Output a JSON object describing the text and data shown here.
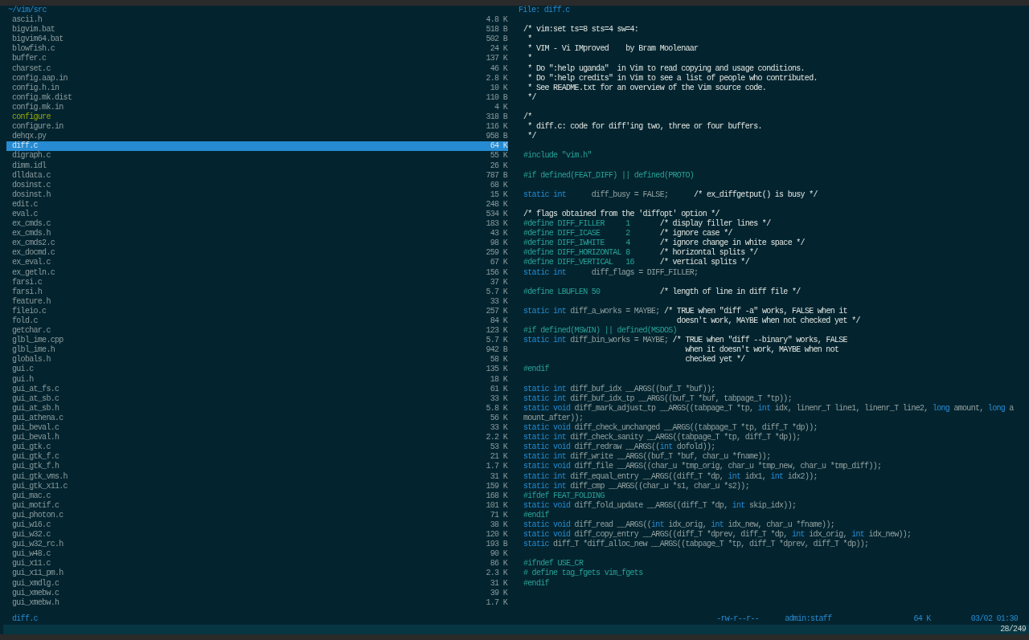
{
  "browser": {
    "path": "~/vim/src",
    "files": [
      {
        "name": "ascii.h",
        "size": "4.8 K",
        "kind": "file",
        "selected": false
      },
      {
        "name": "bigvim.bat",
        "size": "518 B",
        "kind": "file",
        "selected": false
      },
      {
        "name": "bigvim64.bat",
        "size": "502 B",
        "kind": "file",
        "selected": false
      },
      {
        "name": "blowfish.c",
        "size": "24 K",
        "kind": "file",
        "selected": false
      },
      {
        "name": "buffer.c",
        "size": "137 K",
        "kind": "file",
        "selected": false
      },
      {
        "name": "charset.c",
        "size": "46 K",
        "kind": "file",
        "selected": false
      },
      {
        "name": "config.aap.in",
        "size": "2.8 K",
        "kind": "file",
        "selected": false
      },
      {
        "name": "config.h.in",
        "size": "10 K",
        "kind": "file",
        "selected": false
      },
      {
        "name": "config.mk.dist",
        "size": "110 B",
        "kind": "file",
        "selected": false
      },
      {
        "name": "config.mk.in",
        "size": "4 K",
        "kind": "file",
        "selected": false
      },
      {
        "name": "configure",
        "size": "318 B",
        "kind": "executable",
        "selected": false
      },
      {
        "name": "configure.in",
        "size": "116 K",
        "kind": "file",
        "selected": false
      },
      {
        "name": "dehqx.py",
        "size": "958 B",
        "kind": "file",
        "selected": false
      },
      {
        "name": "diff.c",
        "size": "64 K",
        "kind": "file",
        "selected": true
      },
      {
        "name": "digraph.c",
        "size": "55 K",
        "kind": "file",
        "selected": false
      },
      {
        "name": "dimm.idl",
        "size": "26 K",
        "kind": "file",
        "selected": false
      },
      {
        "name": "dlldata.c",
        "size": "787 B",
        "kind": "file",
        "selected": false
      },
      {
        "name": "dosinst.c",
        "size": "68 K",
        "kind": "file",
        "selected": false
      },
      {
        "name": "dosinst.h",
        "size": "15 K",
        "kind": "file",
        "selected": false
      },
      {
        "name": "edit.c",
        "size": "248 K",
        "kind": "file",
        "selected": false
      },
      {
        "name": "eval.c",
        "size": "534 K",
        "kind": "file",
        "selected": false
      },
      {
        "name": "ex_cmds.c",
        "size": "183 K",
        "kind": "file",
        "selected": false
      },
      {
        "name": "ex_cmds.h",
        "size": "43 K",
        "kind": "file",
        "selected": false
      },
      {
        "name": "ex_cmds2.c",
        "size": "98 K",
        "kind": "file",
        "selected": false
      },
      {
        "name": "ex_docmd.c",
        "size": "259 K",
        "kind": "file",
        "selected": false
      },
      {
        "name": "ex_eval.c",
        "size": "67 K",
        "kind": "file",
        "selected": false
      },
      {
        "name": "ex_getln.c",
        "size": "156 K",
        "kind": "file",
        "selected": false
      },
      {
        "name": "farsi.c",
        "size": "37 K",
        "kind": "file",
        "selected": false
      },
      {
        "name": "farsi.h",
        "size": "5.7 K",
        "kind": "file",
        "selected": false
      },
      {
        "name": "feature.h",
        "size": "33 K",
        "kind": "file",
        "selected": false
      },
      {
        "name": "fileio.c",
        "size": "257 K",
        "kind": "file",
        "selected": false
      },
      {
        "name": "fold.c",
        "size": "84 K",
        "kind": "file",
        "selected": false
      },
      {
        "name": "getchar.c",
        "size": "123 K",
        "kind": "file",
        "selected": false
      },
      {
        "name": "glbl_ime.cpp",
        "size": "5.7 K",
        "kind": "file",
        "selected": false
      },
      {
        "name": "glbl_ime.h",
        "size": "942 B",
        "kind": "file",
        "selected": false
      },
      {
        "name": "globals.h",
        "size": "58 K",
        "kind": "file",
        "selected": false
      },
      {
        "name": "gui.c",
        "size": "135 K",
        "kind": "file",
        "selected": false
      },
      {
        "name": "gui.h",
        "size": "18 K",
        "kind": "file",
        "selected": false
      },
      {
        "name": "gui_at_fs.c",
        "size": "61 K",
        "kind": "file",
        "selected": false
      },
      {
        "name": "gui_at_sb.c",
        "size": "33 K",
        "kind": "file",
        "selected": false
      },
      {
        "name": "gui_at_sb.h",
        "size": "5.8 K",
        "kind": "file",
        "selected": false
      },
      {
        "name": "gui_athena.c",
        "size": "56 K",
        "kind": "file",
        "selected": false
      },
      {
        "name": "gui_beval.c",
        "size": "33 K",
        "kind": "file",
        "selected": false
      },
      {
        "name": "gui_beval.h",
        "size": "2.2 K",
        "kind": "file",
        "selected": false
      },
      {
        "name": "gui_gtk.c",
        "size": "53 K",
        "kind": "file",
        "selected": false
      },
      {
        "name": "gui_gtk_f.c",
        "size": "21 K",
        "kind": "file",
        "selected": false
      },
      {
        "name": "gui_gtk_f.h",
        "size": "1.7 K",
        "kind": "file",
        "selected": false
      },
      {
        "name": "gui_gtk_vms.h",
        "size": "31 K",
        "kind": "file",
        "selected": false
      },
      {
        "name": "gui_gtk_x11.c",
        "size": "159 K",
        "kind": "file",
        "selected": false
      },
      {
        "name": "gui_mac.c",
        "size": "168 K",
        "kind": "file",
        "selected": false
      },
      {
        "name": "gui_motif.c",
        "size": "101 K",
        "kind": "file",
        "selected": false
      },
      {
        "name": "gui_photon.c",
        "size": "71 K",
        "kind": "file",
        "selected": false
      },
      {
        "name": "gui_w16.c",
        "size": "38 K",
        "kind": "file",
        "selected": false
      },
      {
        "name": "gui_w32.c",
        "size": "120 K",
        "kind": "file",
        "selected": false
      },
      {
        "name": "gui_w32_rc.h",
        "size": "193 B",
        "kind": "file",
        "selected": false
      },
      {
        "name": "gui_w48.c",
        "size": "90 K",
        "kind": "file",
        "selected": false
      },
      {
        "name": "gui_x11.c",
        "size": "86 K",
        "kind": "file",
        "selected": false
      },
      {
        "name": "gui_x11_pm.h",
        "size": "2.3 K",
        "kind": "file",
        "selected": false
      },
      {
        "name": "gui_xmdlg.c",
        "size": "31 K",
        "kind": "file",
        "selected": false
      },
      {
        "name": "gui_xmebw.c",
        "size": "39 K",
        "kind": "file",
        "selected": false
      },
      {
        "name": "gui_xmebw.h",
        "size": "1.7 K",
        "kind": "file",
        "selected": false
      }
    ],
    "current_file": "diff.c"
  },
  "preview": {
    "title": "File: diff.c",
    "lines": [
      {
        "kind": "code",
        "segments": [
          {
            "kind": "comment",
            "text": "/* vim:set ts=8 sts=4 sw=4:"
          }
        ]
      },
      {
        "kind": "code",
        "segments": [
          {
            "kind": "comment",
            "text": " *"
          }
        ]
      },
      {
        "kind": "code",
        "segments": [
          {
            "kind": "comment",
            "text": " * VIM - Vi IMproved    by Bram Moolenaar"
          }
        ]
      },
      {
        "kind": "code",
        "segments": [
          {
            "kind": "comment",
            "text": " *"
          }
        ]
      },
      {
        "kind": "code",
        "segments": [
          {
            "kind": "comment",
            "text": " * Do \":help uganda\"  in Vim to read copying and usage conditions."
          }
        ]
      },
      {
        "kind": "code",
        "segments": [
          {
            "kind": "comment",
            "text": " * Do \":help credits\" in Vim to see a list of people who contributed."
          }
        ]
      },
      {
        "kind": "code",
        "segments": [
          {
            "kind": "comment",
            "text": " * See README.txt for an overview of the Vim source code."
          }
        ]
      },
      {
        "kind": "code",
        "segments": [
          {
            "kind": "comment",
            "text": " */"
          }
        ]
      },
      {
        "kind": "blank"
      },
      {
        "kind": "code",
        "segments": [
          {
            "kind": "comment",
            "text": "/*"
          }
        ]
      },
      {
        "kind": "code",
        "segments": [
          {
            "kind": "comment",
            "text": " * diff.c: code for diff'ing two, three or four buffers."
          }
        ]
      },
      {
        "kind": "code",
        "segments": [
          {
            "kind": "comment",
            "text": " */"
          }
        ]
      },
      {
        "kind": "blank"
      },
      {
        "kind": "code",
        "segments": [
          {
            "kind": "preproc",
            "text": "#include \"vim.h\""
          }
        ]
      },
      {
        "kind": "blank"
      },
      {
        "kind": "code",
        "segments": [
          {
            "kind": "preproc",
            "text": "#if defined(FEAT_DIFF) || defined(PROTO)"
          }
        ]
      },
      {
        "kind": "blank"
      },
      {
        "kind": "code",
        "segments": [
          {
            "kind": "keyword",
            "text": "static int"
          },
          {
            "kind": "plain",
            "text": "      diff_busy = FALSE;      "
          },
          {
            "kind": "comment",
            "text": "/* ex_diffgetput() is busy */"
          }
        ]
      },
      {
        "kind": "blank"
      },
      {
        "kind": "code",
        "segments": [
          {
            "kind": "comment",
            "text": "/* flags obtained from the 'diffopt' option */"
          }
        ]
      },
      {
        "kind": "code",
        "segments": [
          {
            "kind": "preproc",
            "text": "#define DIFF_FILLER     1       "
          },
          {
            "kind": "comment",
            "text": "/* display filler lines */"
          }
        ]
      },
      {
        "kind": "code",
        "segments": [
          {
            "kind": "preproc",
            "text": "#define DIFF_ICASE      2       "
          },
          {
            "kind": "comment",
            "text": "/* ignore case */"
          }
        ]
      },
      {
        "kind": "code",
        "segments": [
          {
            "kind": "preproc",
            "text": "#define DIFF_IWHITE     4       "
          },
          {
            "kind": "comment",
            "text": "/* ignore change in white space */"
          }
        ]
      },
      {
        "kind": "code",
        "segments": [
          {
            "kind": "preproc",
            "text": "#define DIFF_HORIZONTAL 8       "
          },
          {
            "kind": "comment",
            "text": "/* horizontal splits */"
          }
        ]
      },
      {
        "kind": "code",
        "segments": [
          {
            "kind": "preproc",
            "text": "#define DIFF_VERTICAL   16      "
          },
          {
            "kind": "comment",
            "text": "/* vertical splits */"
          }
        ]
      },
      {
        "kind": "code",
        "segments": [
          {
            "kind": "keyword",
            "text": "static int"
          },
          {
            "kind": "plain",
            "text": "      diff_flags = DIFF_FILLER;"
          }
        ]
      },
      {
        "kind": "blank"
      },
      {
        "kind": "code",
        "segments": [
          {
            "kind": "preproc",
            "text": "#define LBUFLEN 50              "
          },
          {
            "kind": "comment",
            "text": "/* length of line in diff file */"
          }
        ]
      },
      {
        "kind": "blank"
      },
      {
        "kind": "code",
        "segments": [
          {
            "kind": "keyword",
            "text": "static int"
          },
          {
            "kind": "plain",
            "text": " diff_a_works = MAYBE; "
          },
          {
            "kind": "comment",
            "text": "/* TRUE when \"diff -a\" works, FALSE when it"
          }
        ]
      },
      {
        "kind": "code",
        "segments": [
          {
            "kind": "comment",
            "text": "                                    doesn't work, MAYBE when not checked yet */"
          }
        ]
      },
      {
        "kind": "code",
        "segments": [
          {
            "kind": "preproc",
            "text": "#if defined(MSWIN) || defined(MSDOS)"
          }
        ]
      },
      {
        "kind": "code",
        "segments": [
          {
            "kind": "keyword",
            "text": "static int"
          },
          {
            "kind": "plain",
            "text": " diff_bin_works = MAYBE; "
          },
          {
            "kind": "comment",
            "text": "/* TRUE when \"diff --binary\" works, FALSE"
          }
        ]
      },
      {
        "kind": "code",
        "segments": [
          {
            "kind": "comment",
            "text": "                                      when it doesn't work, MAYBE when not"
          }
        ]
      },
      {
        "kind": "code",
        "segments": [
          {
            "kind": "comment",
            "text": "                                      checked yet */"
          }
        ]
      },
      {
        "kind": "code",
        "segments": [
          {
            "kind": "preproc",
            "text": "#endif"
          }
        ]
      },
      {
        "kind": "blank"
      },
      {
        "kind": "code",
        "segments": [
          {
            "kind": "keyword",
            "text": "static int"
          },
          {
            "kind": "plain",
            "text": " diff_buf_idx __ARGS((buf_T *buf));"
          }
        ]
      },
      {
        "kind": "code",
        "segments": [
          {
            "kind": "keyword",
            "text": "static int"
          },
          {
            "kind": "plain",
            "text": " diff_buf_idx_tp __ARGS((buf_T *buf, tabpage_T *tp));"
          }
        ]
      },
      {
        "kind": "code",
        "segments": [
          {
            "kind": "keyword",
            "text": "static void"
          },
          {
            "kind": "plain",
            "text": " diff_mark_adjust_tp __ARGS((tabpage_T *tp, "
          },
          {
            "kind": "keyword",
            "text": "int"
          },
          {
            "kind": "plain",
            "text": " idx, linenr_T line1, linenr_T line2, "
          },
          {
            "kind": "keyword",
            "text": "long"
          },
          {
            "kind": "plain",
            "text": " amount, "
          },
          {
            "kind": "keyword",
            "text": "long"
          },
          {
            "kind": "plain",
            "text": " a"
          }
        ]
      },
      {
        "kind": "code",
        "segments": [
          {
            "kind": "plain",
            "text": "mount_after));"
          }
        ]
      },
      {
        "kind": "code",
        "segments": [
          {
            "kind": "keyword",
            "text": "static void"
          },
          {
            "kind": "plain",
            "text": " diff_check_unchanged __ARGS((tabpage_T *tp, diff_T *dp));"
          }
        ]
      },
      {
        "kind": "code",
        "segments": [
          {
            "kind": "keyword",
            "text": "static int"
          },
          {
            "kind": "plain",
            "text": " diff_check_sanity __ARGS((tabpage_T *tp, diff_T *dp));"
          }
        ]
      },
      {
        "kind": "code",
        "segments": [
          {
            "kind": "keyword",
            "text": "static void"
          },
          {
            "kind": "plain",
            "text": " diff_redraw __ARGS(("
          },
          {
            "kind": "keyword",
            "text": "int"
          },
          {
            "kind": "plain",
            "text": " dofold));"
          }
        ]
      },
      {
        "kind": "code",
        "segments": [
          {
            "kind": "keyword",
            "text": "static int"
          },
          {
            "kind": "plain",
            "text": " diff_write __ARGS((buf_T *buf, char_u *fname));"
          }
        ]
      },
      {
        "kind": "code",
        "segments": [
          {
            "kind": "keyword",
            "text": "static void"
          },
          {
            "kind": "plain",
            "text": " diff_file __ARGS((char_u *tmp_orig, char_u *tmp_new, char_u *tmp_diff));"
          }
        ]
      },
      {
        "kind": "code",
        "segments": [
          {
            "kind": "keyword",
            "text": "static int"
          },
          {
            "kind": "plain",
            "text": " diff_equal_entry __ARGS((diff_T *dp, "
          },
          {
            "kind": "keyword",
            "text": "int"
          },
          {
            "kind": "plain",
            "text": " idx1, "
          },
          {
            "kind": "keyword",
            "text": "int"
          },
          {
            "kind": "plain",
            "text": " idx2));"
          }
        ]
      },
      {
        "kind": "code",
        "segments": [
          {
            "kind": "keyword",
            "text": "static int"
          },
          {
            "kind": "plain",
            "text": " diff_cmp __ARGS((char_u *s1, char_u *s2));"
          }
        ]
      },
      {
        "kind": "code",
        "segments": [
          {
            "kind": "preproc",
            "text": "#ifdef FEAT_FOLDING"
          }
        ]
      },
      {
        "kind": "code",
        "segments": [
          {
            "kind": "keyword",
            "text": "static void"
          },
          {
            "kind": "plain",
            "text": " diff_fold_update __ARGS((diff_T *dp, "
          },
          {
            "kind": "keyword",
            "text": "int"
          },
          {
            "kind": "plain",
            "text": " skip_idx));"
          }
        ]
      },
      {
        "kind": "code",
        "segments": [
          {
            "kind": "preproc",
            "text": "#endif"
          }
        ]
      },
      {
        "kind": "code",
        "segments": [
          {
            "kind": "keyword",
            "text": "static void"
          },
          {
            "kind": "plain",
            "text": " diff_read __ARGS(("
          },
          {
            "kind": "keyword",
            "text": "int"
          },
          {
            "kind": "plain",
            "text": " idx_orig, "
          },
          {
            "kind": "keyword",
            "text": "int"
          },
          {
            "kind": "plain",
            "text": " idx_new, char_u *fname));"
          }
        ]
      },
      {
        "kind": "code",
        "segments": [
          {
            "kind": "keyword",
            "text": "static void"
          },
          {
            "kind": "plain",
            "text": " diff_copy_entry __ARGS((diff_T *dprev, diff_T *dp, "
          },
          {
            "kind": "keyword",
            "text": "int"
          },
          {
            "kind": "plain",
            "text": " idx_orig, "
          },
          {
            "kind": "keyword",
            "text": "int"
          },
          {
            "kind": "plain",
            "text": " idx_new));"
          }
        ]
      },
      {
        "kind": "code",
        "segments": [
          {
            "kind": "keyword",
            "text": "static"
          },
          {
            "kind": "plain",
            "text": " diff_T *diff_alloc_new __ARGS((tabpage_T *tp, diff_T *dprev, diff_T *dp));"
          }
        ]
      },
      {
        "kind": "blank"
      },
      {
        "kind": "code",
        "segments": [
          {
            "kind": "preproc",
            "text": "#ifndef USE_CR"
          }
        ]
      },
      {
        "kind": "code",
        "segments": [
          {
            "kind": "preproc",
            "text": "# define tag_fgets vim_fgets"
          }
        ]
      },
      {
        "kind": "code",
        "segments": [
          {
            "kind": "preproc",
            "text": "#endif"
          }
        ]
      }
    ],
    "file_info": {
      "permissions": "-rw-r--r--",
      "owner": "admin:staff",
      "size": "64 K",
      "modified": "03/02 01:30"
    }
  },
  "status_bar": {
    "position": "28/249"
  }
}
